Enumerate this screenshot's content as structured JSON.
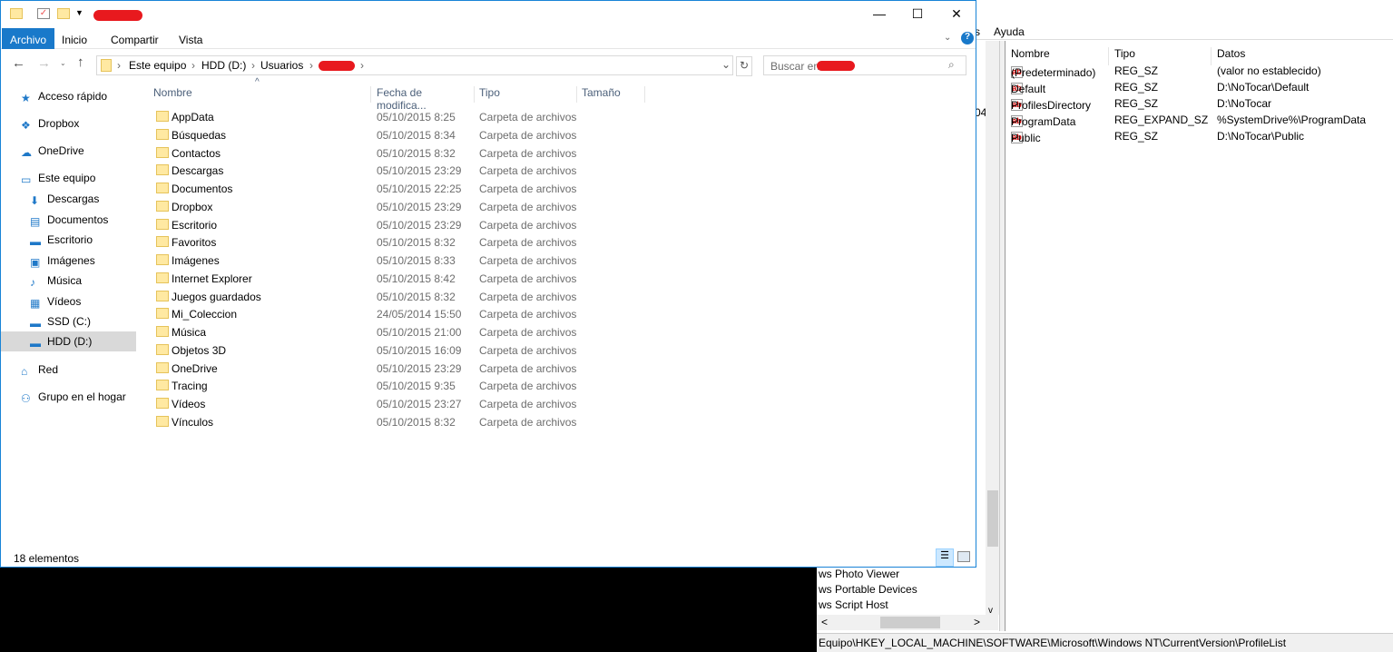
{
  "explorer": {
    "ribbon_tabs": [
      "Archivo",
      "Inicio",
      "Compartir",
      "Vista"
    ],
    "breadcrumb": [
      "Este equipo",
      "HDD (D:)",
      "Usuarios"
    ],
    "search_placeholder": "Buscar en",
    "sidebar": [
      {
        "label": "Acceso rápido",
        "icon": "star-icon"
      },
      {
        "label": "Dropbox",
        "icon": "dropbox-icon"
      },
      {
        "label": "OneDrive",
        "icon": "cloud-icon"
      },
      {
        "label": "Este equipo",
        "icon": "computer-icon"
      },
      {
        "label": "Descargas",
        "icon": "download-icon"
      },
      {
        "label": "Documentos",
        "icon": "document-icon"
      },
      {
        "label": "Escritorio",
        "icon": "desktop-icon"
      },
      {
        "label": "Imágenes",
        "icon": "image-icon"
      },
      {
        "label": "Música",
        "icon": "music-icon"
      },
      {
        "label": "Vídeos",
        "icon": "video-icon"
      },
      {
        "label": "SSD (C:)",
        "icon": "drive-icon"
      },
      {
        "label": "HDD (D:)",
        "icon": "drive-icon",
        "selected": true
      },
      {
        "label": "Red",
        "icon": "network-icon"
      },
      {
        "label": "Grupo en el hogar",
        "icon": "homegroup-icon"
      }
    ],
    "columns": [
      "Nombre",
      "Fecha de modifica...",
      "Tipo",
      "Tamaño"
    ],
    "files": [
      [
        "AppData",
        "05/10/2015 8:25",
        "Carpeta de archivos"
      ],
      [
        "Búsquedas",
        "05/10/2015 8:34",
        "Carpeta de archivos"
      ],
      [
        "Contactos",
        "05/10/2015 8:32",
        "Carpeta de archivos"
      ],
      [
        "Descargas",
        "05/10/2015 23:29",
        "Carpeta de archivos"
      ],
      [
        "Documentos",
        "05/10/2015 22:25",
        "Carpeta de archivos"
      ],
      [
        "Dropbox",
        "05/10/2015 23:29",
        "Carpeta de archivos"
      ],
      [
        "Escritorio",
        "05/10/2015 23:29",
        "Carpeta de archivos"
      ],
      [
        "Favoritos",
        "05/10/2015 8:32",
        "Carpeta de archivos"
      ],
      [
        "Imágenes",
        "05/10/2015 8:33",
        "Carpeta de archivos"
      ],
      [
        "Internet Explorer",
        "05/10/2015 8:42",
        "Carpeta de archivos"
      ],
      [
        "Juegos guardados",
        "05/10/2015 8:32",
        "Carpeta de archivos"
      ],
      [
        "Mi_Coleccion",
        "24/05/2014 15:50",
        "Carpeta de archivos"
      ],
      [
        "Música",
        "05/10/2015 21:00",
        "Carpeta de archivos"
      ],
      [
        "Objetos 3D",
        "05/10/2015 16:09",
        "Carpeta de archivos"
      ],
      [
        "OneDrive",
        "05/10/2015 23:29",
        "Carpeta de archivos"
      ],
      [
        "Tracing",
        "05/10/2015 9:35",
        "Carpeta de archivos"
      ],
      [
        "Vídeos",
        "05/10/2015 23:27",
        "Carpeta de archivos"
      ],
      [
        "Vínculos",
        "05/10/2015 8:32",
        "Carpeta de archivos"
      ]
    ],
    "status": "18 elementos"
  },
  "registry": {
    "menu_partial": "s",
    "menu_help": "Ayuda",
    "tree_partial": "04",
    "tree_items": [
      "ws Photo Viewer",
      "ws Portable Devices",
      "ws Script Host"
    ],
    "columns": [
      "Nombre",
      "Tipo",
      "Datos"
    ],
    "values": [
      [
        "(Predeterminado)",
        "REG_SZ",
        "(valor no establecido)"
      ],
      [
        "Default",
        "REG_SZ",
        "D:\\NoTocar\\Default"
      ],
      [
        "ProfilesDirectory",
        "REG_SZ",
        "D:\\NoTocar"
      ],
      [
        "ProgramData",
        "REG_EXPAND_SZ",
        "%SystemDrive%\\ProgramData"
      ],
      [
        "Public",
        "REG_SZ",
        "D:\\NoTocar\\Public"
      ]
    ],
    "status": "Equipo\\HKEY_LOCAL_MACHINE\\SOFTWARE\\Microsoft\\Windows NT\\CurrentVersion\\ProfileList"
  },
  "colors": {
    "accent": "#1979ca",
    "redaction": "#e8191e"
  }
}
